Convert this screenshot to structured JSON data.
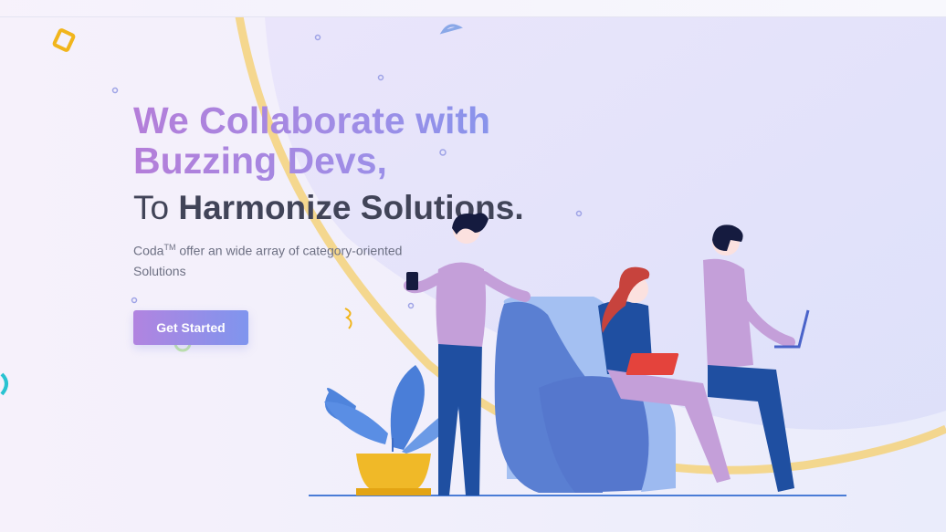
{
  "hero": {
    "headline_line1": "We Collaborate with",
    "headline_line2": "Buzzing Devs,",
    "subline_prefix": "To",
    "subline_bold": "Harmonize Solutions.",
    "description_brand": "Coda",
    "description_trademark": "TM",
    "description_text": " offer an wide array of category-oriented Solutions"
  },
  "cta": {
    "label": "Get Started"
  },
  "colors": {
    "gradient_start": "#b47ed9",
    "gradient_end": "#7c97ee",
    "heading_dark": "#414458",
    "ring_yellow": "#f4d27a",
    "chair_blue": "#5376c9"
  },
  "illustration": {
    "icons": [
      "plant-icon",
      "phone-icon",
      "laptop-icon",
      "armchair-icon"
    ]
  }
}
